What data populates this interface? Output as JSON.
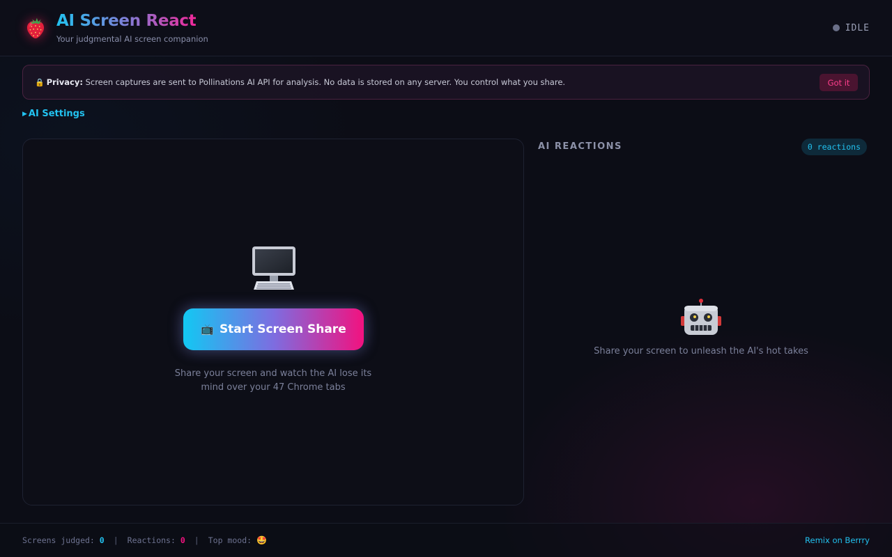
{
  "header": {
    "logo_icon": "strawberry-icon",
    "title": "AI Screen React",
    "subtitle": "Your judgmental AI screen companion",
    "status": "IDLE",
    "status_color": "#6a6f88"
  },
  "privacy": {
    "icon": "lock-icon",
    "label": "Privacy:",
    "message": "Screen captures are sent to Pollinations AI API for analysis. No data is stored on any server. You control what you share.",
    "dismiss_label": "Got it"
  },
  "settings": {
    "caret": "▶",
    "label": "AI Settings"
  },
  "stage": {
    "icon": "desktop-monitor-icon",
    "start_icon": "tv-icon",
    "start_label": "Start Screen Share",
    "hint_line1": "Share your screen and watch the AI lose its",
    "hint_line2": "mind over your 47 Chrome tabs"
  },
  "reactions": {
    "title": "AI REACTIONS",
    "count_label": "0 reactions",
    "empty_icon": "robot-icon",
    "empty_message": "Share your screen to unleash the AI's hot takes"
  },
  "footer": {
    "screens_label": "Screens judged:",
    "screens_value": "0",
    "reactions_label": "Reactions:",
    "reactions_value": "0",
    "mood_label": "Top mood:",
    "mood_icon": "star-struck-face-icon",
    "separator": "|",
    "remix_label": "Remix on Berrry"
  },
  "colors": {
    "accent_cyan": "#22c2f0",
    "accent_pink": "#f2127f",
    "background": "#0c0d16"
  }
}
